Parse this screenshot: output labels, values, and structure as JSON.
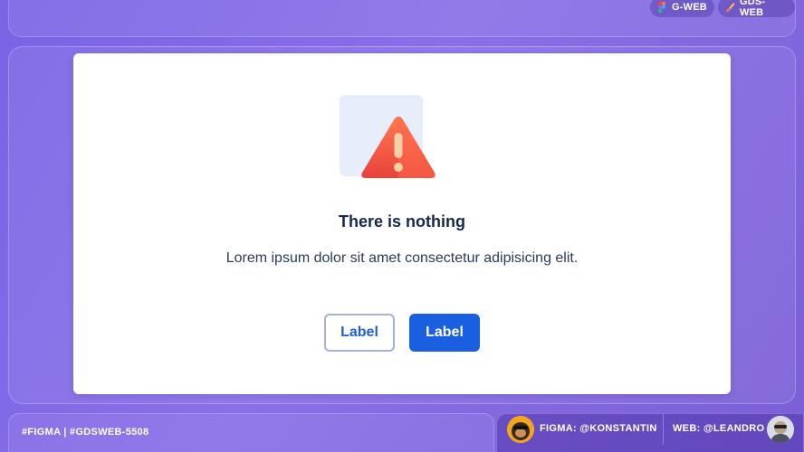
{
  "topbar": {
    "chips": [
      {
        "label": "G-WEB",
        "icon": "figma-icon"
      },
      {
        "label": "GDS-WEB",
        "icon": "brush-icon"
      }
    ]
  },
  "card": {
    "icon": "warning-triangle-icon",
    "title": "There is nothing",
    "description": "Lorem ipsum dolor sit amet consectetur adipisicing elit.",
    "secondary_button": "Label",
    "primary_button": "Label"
  },
  "footer": {
    "tags": "#FIGMA | #GDSWEB-5508",
    "figma_credit": "FIGMA: @KONSTANTIN",
    "web_credit": "WEB: @LEANDRO"
  },
  "colors": {
    "background": "#7b63e6",
    "primary": "#1a5fe0",
    "warning": "#f25a3e",
    "title": "#17264d"
  }
}
